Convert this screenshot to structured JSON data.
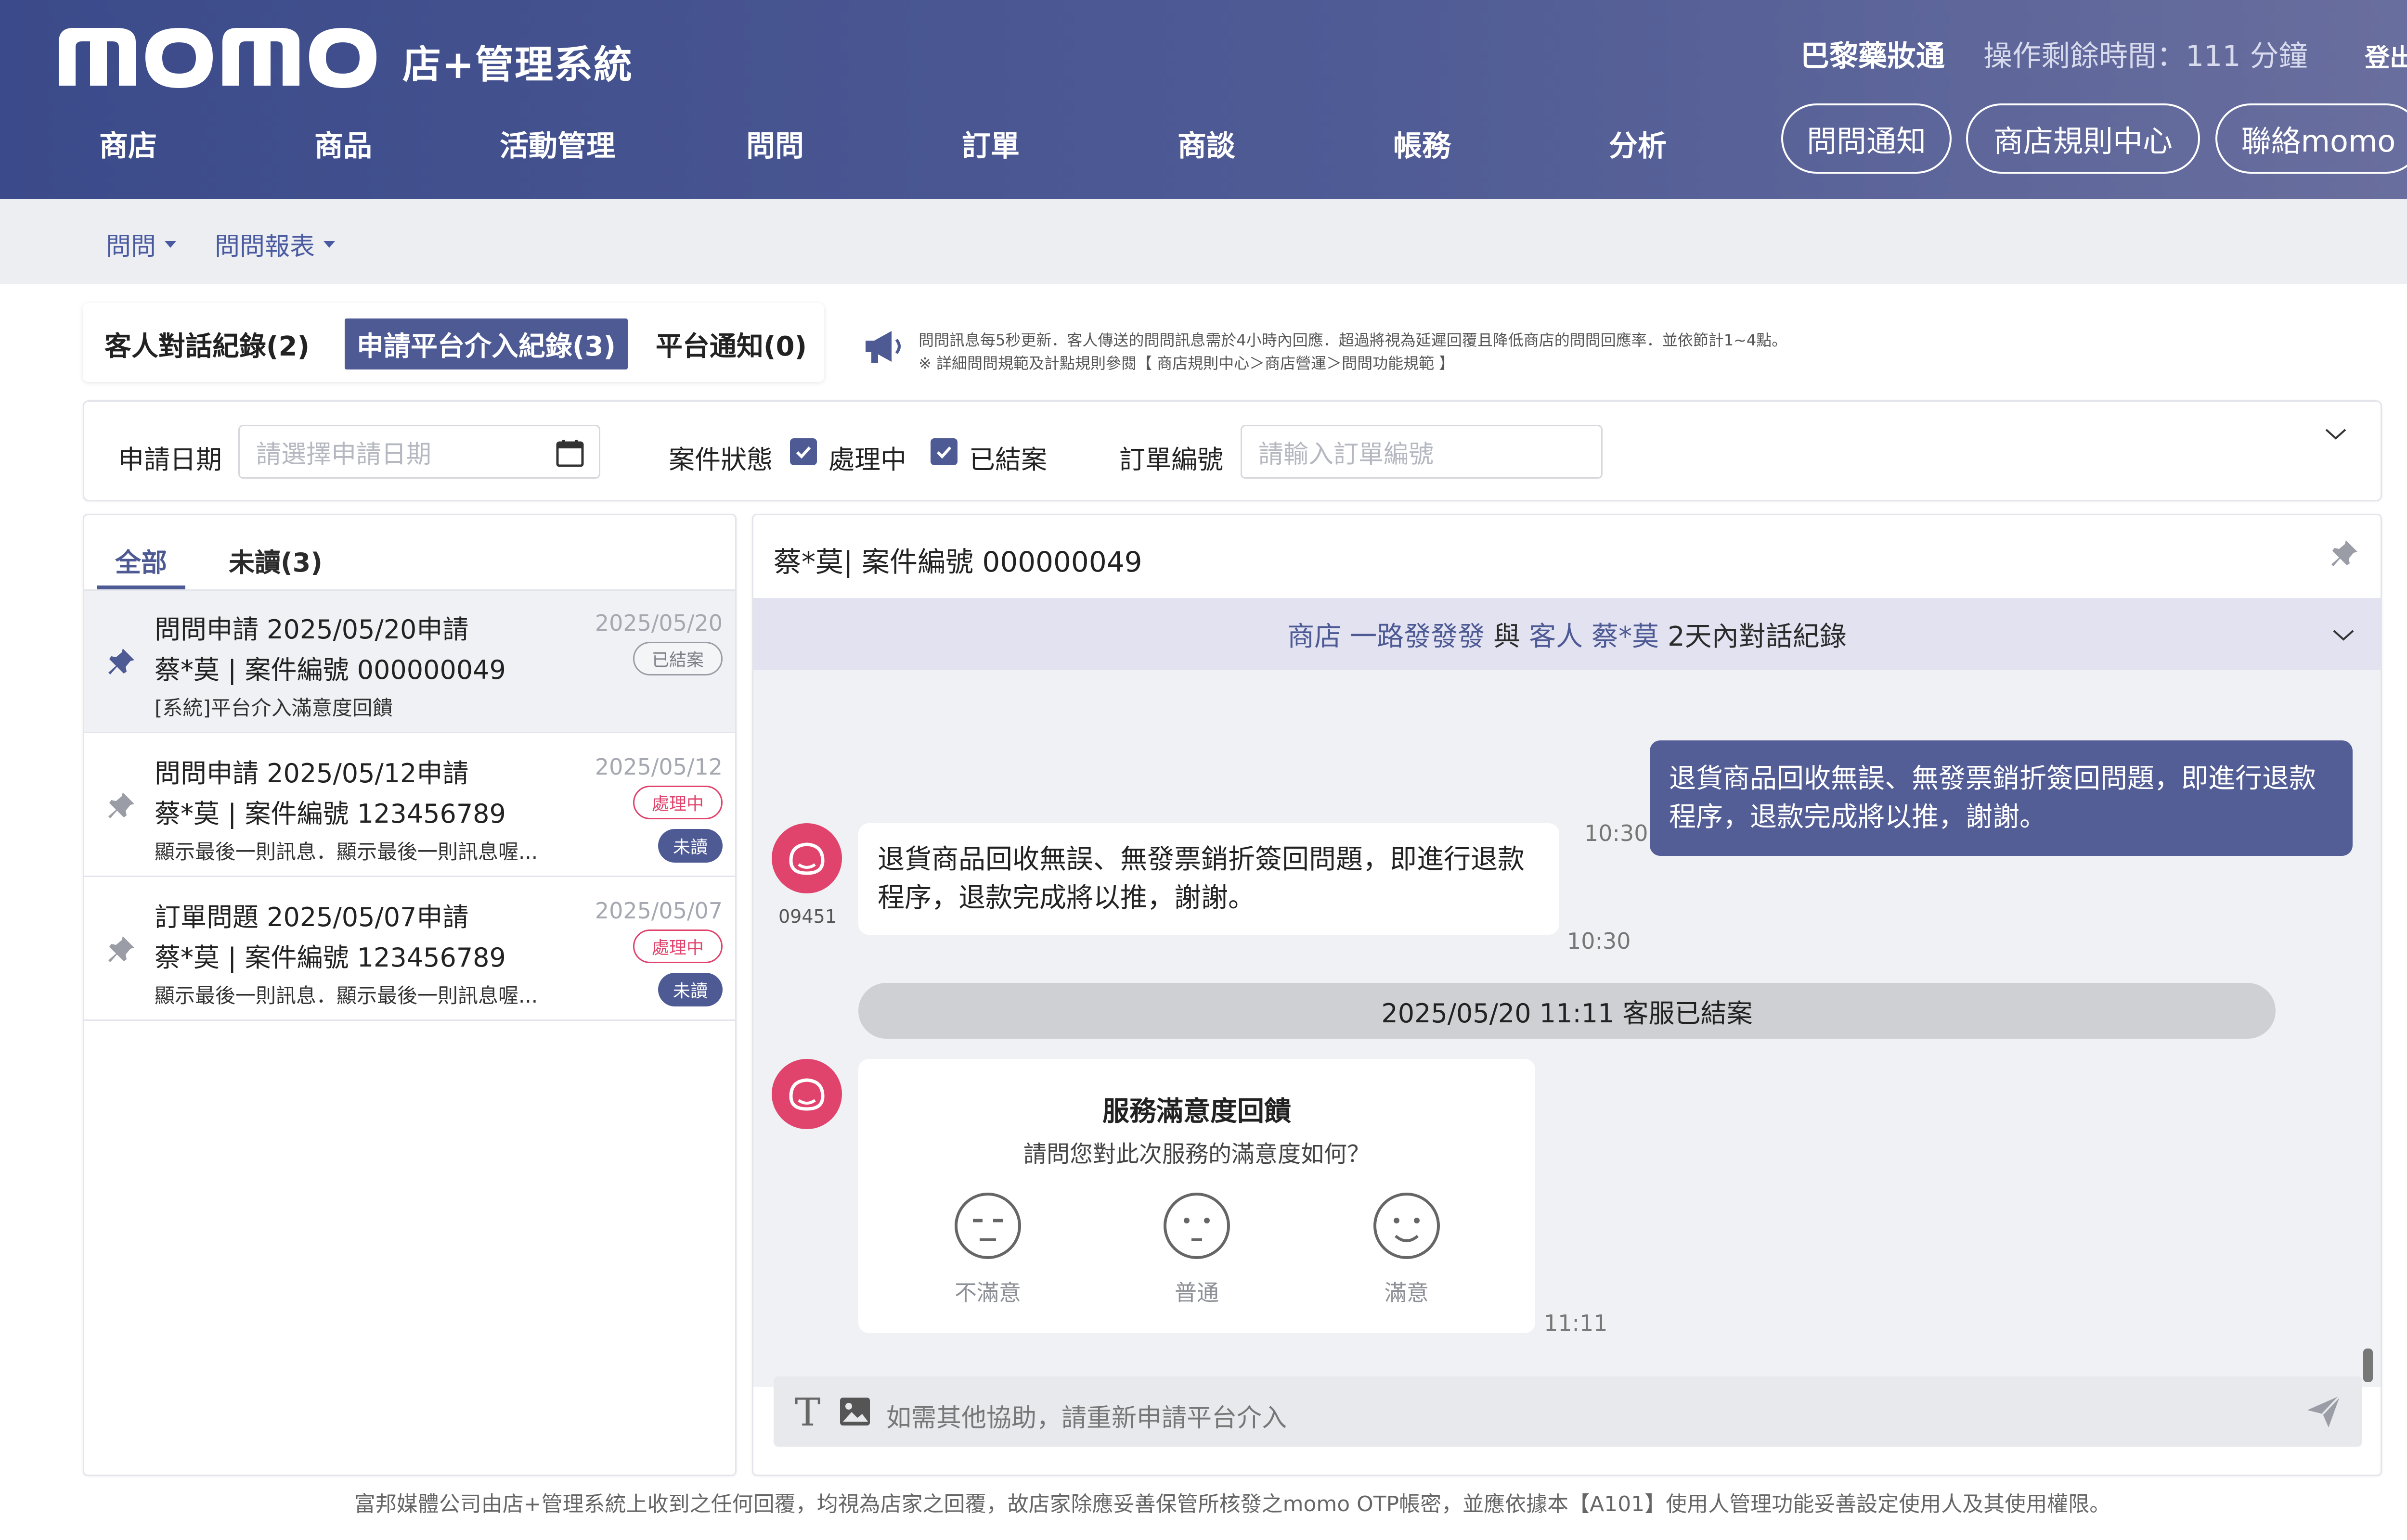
{
  "header": {
    "logo_text": "momo",
    "logo_sub": "店+管理系統",
    "store_name": "巴黎藥妝通",
    "time_left": "操作剩餘時間：111 分鐘",
    "logout": "登出",
    "nav": [
      "商店",
      "商品",
      "活動管理",
      "問問",
      "訂單",
      "商談",
      "帳務",
      "分析"
    ],
    "pills": [
      "問問通知",
      "商店規則中心",
      "聯絡momo"
    ]
  },
  "subnav": [
    "問問",
    "問問報表"
  ],
  "tabs": [
    {
      "label": "客人對話紀錄(2)",
      "active": false
    },
    {
      "label": "申請平台介入紀錄(3)",
      "active": true
    },
    {
      "label": "平台通知(0)",
      "active": false
    }
  ],
  "notice": {
    "line1": "問問訊息每5秒更新．客人傳送的問問訊息需於4小時內回應．超過將視為延遲回覆且降低商店的問問回應率．並依節計1~4點。",
    "line2": "※ 詳細問問規範及計點規則參閱【 商店規則中心＞商店營運＞問問功能規範 】"
  },
  "filter": {
    "date_label": "申請日期",
    "date_placeholder": "請選擇申請日期",
    "status_label": "案件狀態",
    "status_options": [
      {
        "label": "處理中",
        "checked": true
      },
      {
        "label": "已結案",
        "checked": true
      }
    ],
    "order_label": "訂單編號",
    "order_placeholder": "請輸入訂單編號"
  },
  "left": {
    "tabs": [
      "全部",
      "未讀(3)"
    ],
    "cases": [
      {
        "title": "問問申請 2025/05/20申請",
        "sub": "蔡*莫 | 案件編號 000000049",
        "msg": "[系統]平台介入滿意度回饋",
        "date": "2025/05/20",
        "status": "已結案",
        "unread": "",
        "pinned": true
      },
      {
        "title": "問問申請 2025/05/12申請",
        "sub": "蔡*莫 | 案件編號 123456789",
        "msg": "顯示最後一則訊息．顯示最後一則訊息喔...",
        "date": "2025/05/12",
        "status": "處理中",
        "unread": "未讀",
        "pinned": false
      },
      {
        "title": "訂單問題 2025/05/07申請",
        "sub": "蔡*莫 | 案件編號 123456789",
        "msg": "顯示最後一則訊息．顯示最後一則訊息喔...",
        "date": "2025/05/07",
        "status": "處理中",
        "unread": "未讀",
        "pinned": false
      }
    ]
  },
  "right": {
    "header": "蔡*莫| 案件編號 000000049",
    "banner": {
      "p1": "商店",
      "store": "一路發發發",
      "p2": "與",
      "p3": "客人",
      "customer": "蔡*莫",
      "p4": "2天內對話紀錄"
    },
    "messages": {
      "out_text": "退貨商品回收無誤、無發票銷折簽回問題，即進行退款程序，退款完成將以推，謝謝。",
      "out_time": "10:30",
      "in_text": "退貨商品回收無誤、無發票銷折簽回問題，即進行退款程序，退款完成將以推，謝謝。",
      "in_time": "10:30",
      "agent_id": "09451",
      "status_line": "2025/05/20 11:11 客服已結案"
    },
    "survey": {
      "title": "服務滿意度回饋",
      "question": "請問您對此次服務的滿意度如何？",
      "options": [
        "不滿意",
        "普通",
        "滿意"
      ],
      "time": "11:11"
    },
    "composer_placeholder": "如需其他協助，請重新申請平台介入",
    "t_icon": "T"
  },
  "footer": "富邦媒體公司由店+管理系統上收到之任何回覆，均視為店家之回覆，故店家除應妥善保管所核發之momo OTP帳密，並應依據本【A101】使用人管理功能妥善設定使用人及其使用權限。",
  "colors": {
    "primary": "#4e5a94",
    "accent_pink": "#e0436b",
    "banner_bg": "#e2e2f1",
    "chat_bg": "#f0f1f4"
  }
}
